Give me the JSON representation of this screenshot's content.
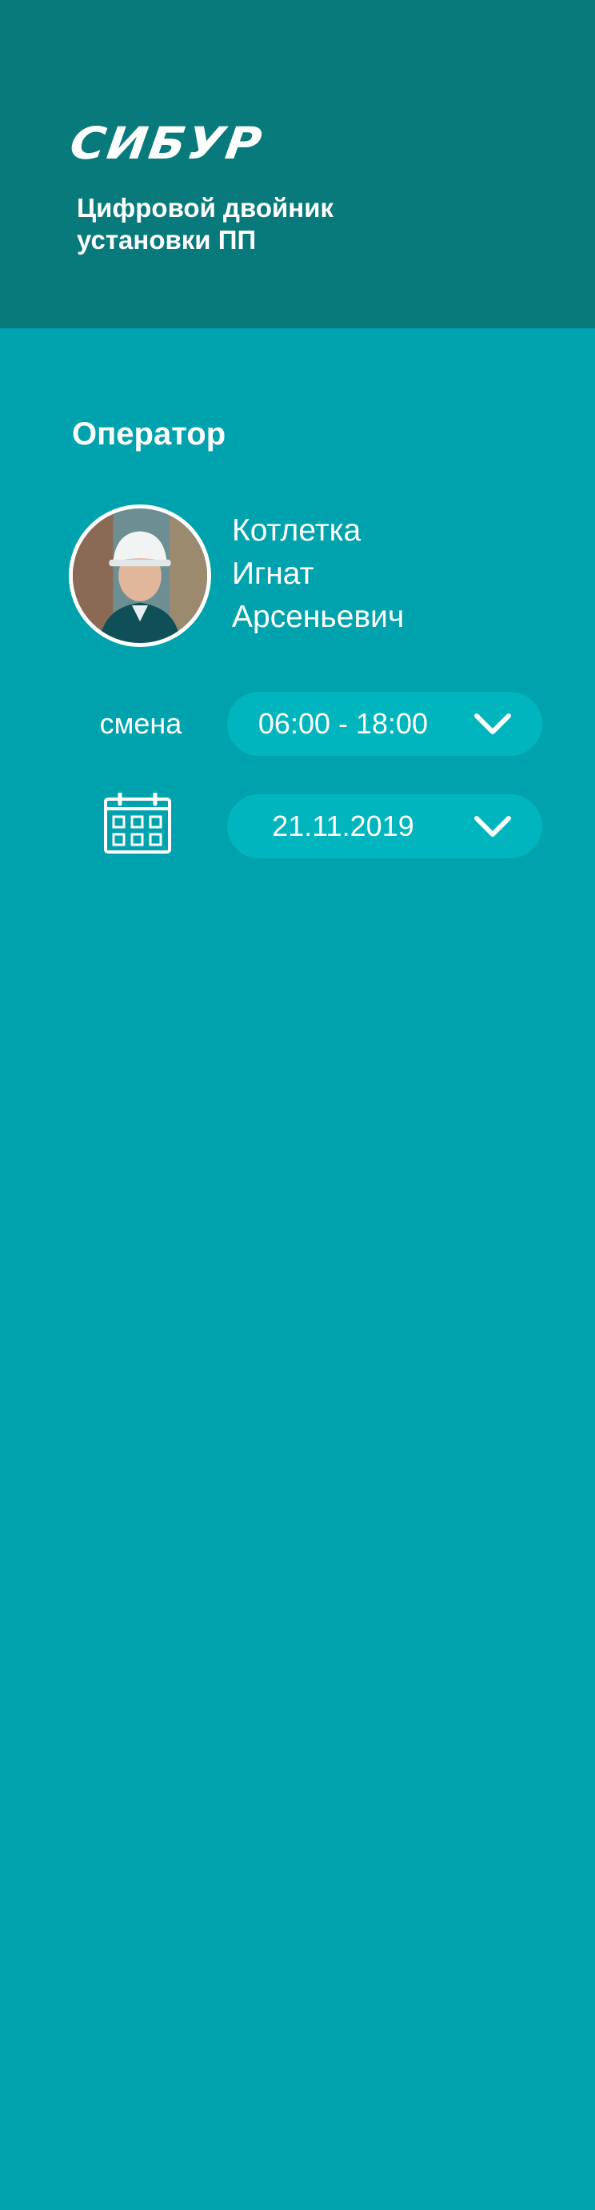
{
  "header": {
    "logo": "СИБУР",
    "subtitle": "Цифровой двойник установки ПП"
  },
  "operator": {
    "section_title": "Оператор",
    "name_lines": [
      "Котлетка",
      "Игнат",
      "Арсеньевич"
    ]
  },
  "shift": {
    "label": "смена",
    "value": "06:00 - 18:00"
  },
  "date": {
    "value": "21.11.2019"
  },
  "icons": {
    "calendar": "calendar-icon",
    "dropdown": "chevron-down-icon"
  },
  "colors": {
    "background": "#00a3ad",
    "header": "#087a7c",
    "dropdown": "#00b5bd",
    "text": "#ffffff"
  }
}
